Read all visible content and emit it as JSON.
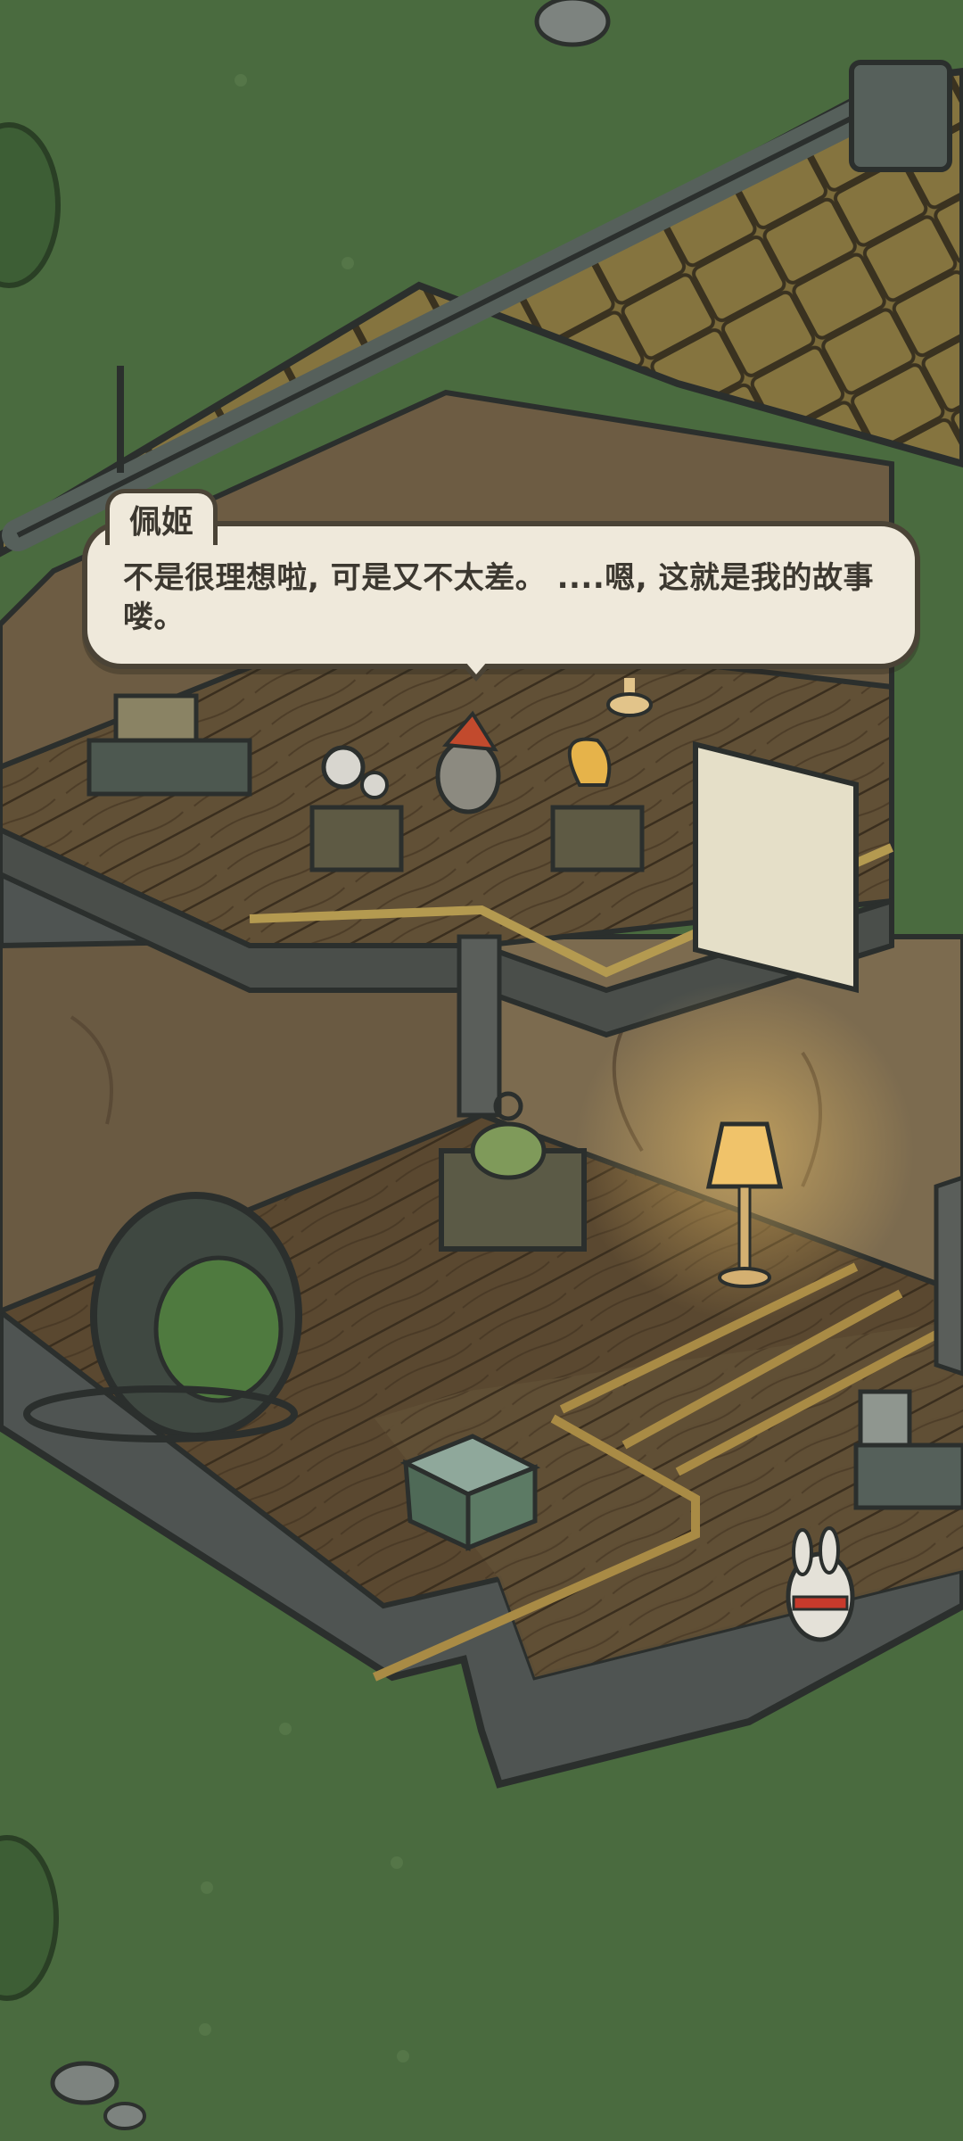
{
  "dialogue": {
    "speaker": "佩姬",
    "text": "不是很理想啦, 可是又不太差。 ....嗯, 这就是我的故事喽。"
  },
  "scene": {
    "grass_color": "#4a6b3f",
    "wood_floor_color": "#5e4a30",
    "roof_color": "#7a6a3a",
    "stone_color": "#4a4e4a",
    "lamp_glow_color": "#f3c66a"
  },
  "icons": [
    "hanging-egg-chair-icon",
    "floor-lamp-icon",
    "kettle-icon",
    "cash-register-icon",
    "bunny-character-icon",
    "squirrel-character-icon",
    "camera-icon",
    "gramophone-icon",
    "rock-icon",
    "bush-icon"
  ]
}
